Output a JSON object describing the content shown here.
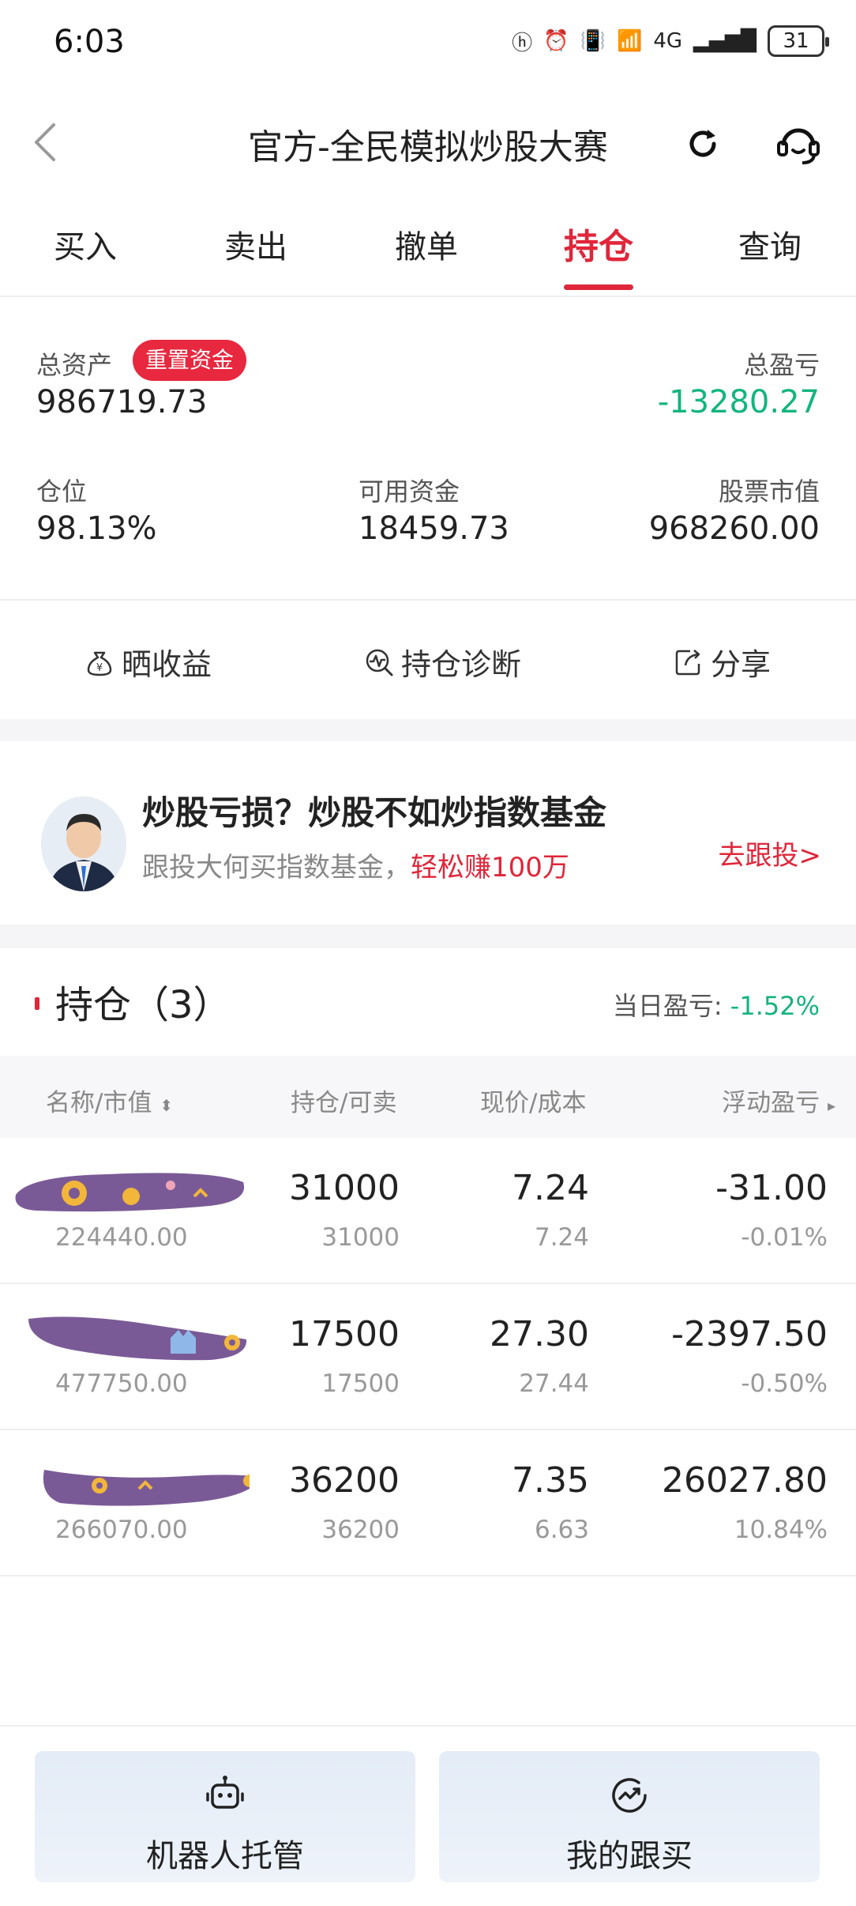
{
  "status_bar": {
    "time": "6:03",
    "battery": "31",
    "network": "4G"
  },
  "header": {
    "title": "官方-全民模拟炒股大赛"
  },
  "tabs": [
    {
      "label": "买入"
    },
    {
      "label": "卖出"
    },
    {
      "label": "撤单"
    },
    {
      "label": "持仓",
      "active": true
    },
    {
      "label": "查询"
    }
  ],
  "summary": {
    "total_assets_label": "总资产",
    "reset_label": "重置资金",
    "total_assets": "986719.73",
    "total_pl_label": "总盈亏",
    "total_pl": "-13280.27",
    "position_label": "仓位",
    "position": "98.13%",
    "available_label": "可用资金",
    "available": "18459.73",
    "market_value_label": "股票市值",
    "market_value": "968260.00"
  },
  "actions": [
    {
      "label": "晒收益",
      "icon": "money-bag-icon"
    },
    {
      "label": "持仓诊断",
      "icon": "diagnosis-icon"
    },
    {
      "label": "分享",
      "icon": "share-icon"
    }
  ],
  "promo": {
    "title": "炒股亏损？炒股不如炒指数基金",
    "subtitle_prefix": "跟投大何买指数基金，",
    "subtitle_highlight": "轻松赚100万",
    "link": "去跟投>"
  },
  "holdings": {
    "title": "持仓（3）",
    "day_pl_label": "当日盈亏:",
    "day_pl": "-1.52%",
    "columns": [
      "名称/市值",
      "持仓/可卖",
      "现价/成本",
      "浮动盈亏"
    ],
    "rows": [
      {
        "market_value": "224440.00",
        "shares": "31000",
        "sellable": "31000",
        "price": "7.24",
        "cost": "7.24",
        "pl": "-31.00",
        "pl_pct": "-0.01%",
        "positive": false
      },
      {
        "market_value": "477750.00",
        "shares": "17500",
        "sellable": "17500",
        "price": "27.30",
        "cost": "27.44",
        "pl": "-2397.50",
        "pl_pct": "-0.50%",
        "positive": false
      },
      {
        "market_value": "266070.00",
        "shares": "36200",
        "sellable": "36200",
        "price": "7.35",
        "cost": "6.63",
        "pl": "26027.80",
        "pl_pct": "10.84%",
        "positive": true
      }
    ]
  },
  "bottom": {
    "robot_label": "机器人托管",
    "follow_label": "我的跟买"
  },
  "colors": {
    "accent_red": "#e0263a",
    "gain_green": "#13b47f"
  }
}
